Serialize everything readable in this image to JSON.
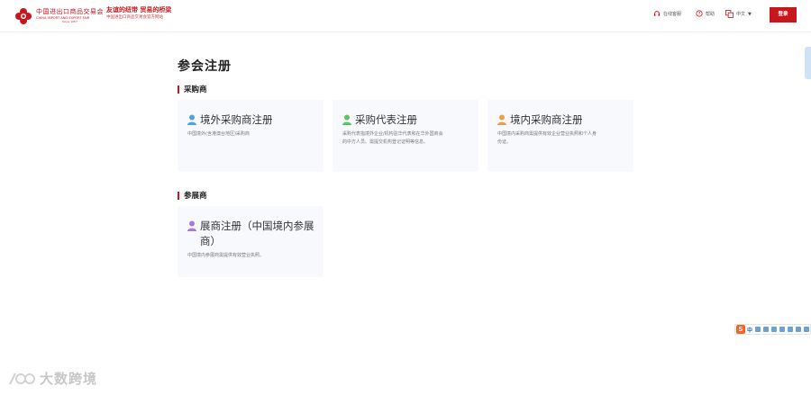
{
  "header": {
    "logo": {
      "cn": "中国进出口商品交易会",
      "en": "CHINA IMPORT AND EXPORT FAIR",
      "since": "Since 1957"
    },
    "slogan": {
      "main": "友谊的纽带 贸易的桥梁",
      "sub": "中国进出口商品交易会官方网站"
    },
    "nav": {
      "service": "在线客服",
      "help": "帮助",
      "language": "中文",
      "login": "登录"
    }
  },
  "page": {
    "title": "参会注册"
  },
  "sections": {
    "buyers": {
      "title": "采购商",
      "cards": [
        {
          "title": "境外采购商注册",
          "desc": "中国境外(含港澳台地区)采购商",
          "icon_color": "#4fa3e0"
        },
        {
          "title": "采购代表注册",
          "desc": "采购代表指境外企业/机构驻华代表和在华外国商会的中方人员。需提交机构登记证明等信息。",
          "icon_color": "#5cc36a"
        },
        {
          "title": "境内采购商注册",
          "desc": "中国境内采购商需提供有效企业营业执照和个人身份证。",
          "icon_color": "#e8a04a"
        }
      ]
    },
    "exhibitors": {
      "title": "参展商",
      "cards": [
        {
          "title": "展商注册（中国境内参展商）",
          "title_line1": "展商注册（中国境内参",
          "title_line2": "展商）",
          "desc": "中国境内参展商需提供有效营业执照。",
          "icon_color": "#a77bd6"
        }
      ]
    }
  },
  "ime": {
    "logo": "S",
    "mode": "中"
  },
  "watermark": {
    "text": "大数跨境"
  },
  "colors": {
    "brand": "#c8161d",
    "card_bg": "#f7f9fc"
  }
}
